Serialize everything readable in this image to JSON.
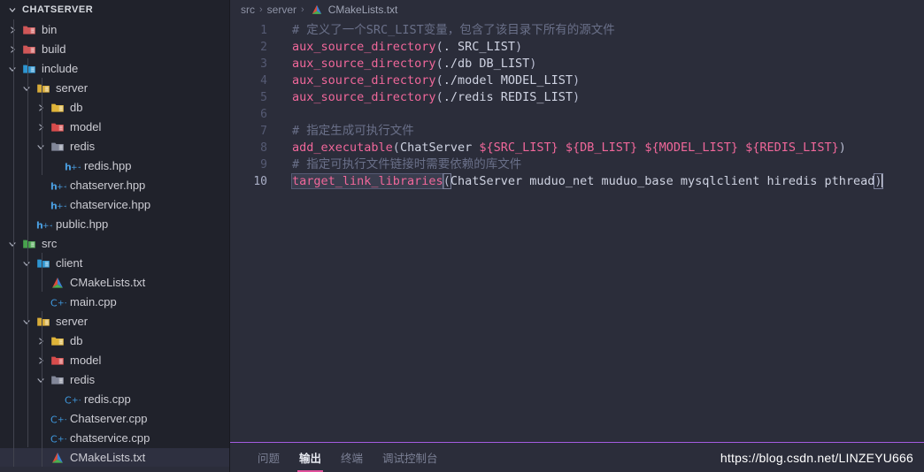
{
  "sidebar": {
    "header": {
      "title": "CHATSERVER",
      "twisty": "chevron-down-icon"
    },
    "items": [
      {
        "label": "bin",
        "depth": 1,
        "twisty": "chevron-right-icon",
        "icon": "folder-icon",
        "color": "#e05c5c",
        "type": "folder"
      },
      {
        "label": "build",
        "depth": 1,
        "twisty": "chevron-right-icon",
        "icon": "folder-icon",
        "color": "#e05c5c",
        "type": "folder"
      },
      {
        "label": "include",
        "depth": 1,
        "twisty": "chevron-down-icon",
        "icon": "folder-icon",
        "color": "#2f9fe0",
        "type": "folder"
      },
      {
        "label": "server",
        "depth": 2,
        "twisty": "chevron-down-icon",
        "icon": "folder-icon",
        "color": "#e8b93a",
        "type": "folder"
      },
      {
        "label": "db",
        "depth": 3,
        "twisty": "chevron-right-icon",
        "icon": "folder-icon",
        "color": "#f0c13b",
        "type": "folder"
      },
      {
        "label": "model",
        "depth": 3,
        "twisty": "chevron-right-icon",
        "icon": "folder-icon",
        "color": "#e8504f",
        "type": "folder"
      },
      {
        "label": "redis",
        "depth": 3,
        "twisty": "chevron-down-icon",
        "icon": "folder-icon",
        "color": "#8b90a3",
        "type": "folder"
      },
      {
        "label": "redis.hpp",
        "depth": 4,
        "twisty": "none",
        "icon": "hpp-file-icon",
        "color": "#4a9ee0",
        "type": "file"
      },
      {
        "label": "chatserver.hpp",
        "depth": 3,
        "twisty": "none",
        "icon": "hpp-file-icon",
        "color": "#4a9ee0",
        "type": "file"
      },
      {
        "label": "chatservice.hpp",
        "depth": 3,
        "twisty": "none",
        "icon": "hpp-file-icon",
        "color": "#4a9ee0",
        "type": "file"
      },
      {
        "label": "public.hpp",
        "depth": 2,
        "twisty": "none",
        "icon": "hpp-file-icon",
        "color": "#4a9ee0",
        "type": "file"
      },
      {
        "label": "src",
        "depth": 1,
        "twisty": "chevron-down-icon",
        "icon": "folder-icon",
        "color": "#4caf50",
        "type": "folder"
      },
      {
        "label": "client",
        "depth": 2,
        "twisty": "chevron-down-icon",
        "icon": "folder-icon",
        "color": "#2f9fe0",
        "type": "folder"
      },
      {
        "label": "CMakeLists.txt",
        "depth": 3,
        "twisty": "none",
        "icon": "cmake-file-icon",
        "color": "#d94f3d",
        "type": "file"
      },
      {
        "label": "main.cpp",
        "depth": 3,
        "twisty": "none",
        "icon": "cpp-file-icon",
        "color": "#4a9ee0",
        "type": "file"
      },
      {
        "label": "server",
        "depth": 2,
        "twisty": "chevron-down-icon",
        "icon": "folder-icon",
        "color": "#e8b93a",
        "type": "folder"
      },
      {
        "label": "db",
        "depth": 3,
        "twisty": "chevron-right-icon",
        "icon": "folder-icon",
        "color": "#f0c13b",
        "type": "folder"
      },
      {
        "label": "model",
        "depth": 3,
        "twisty": "chevron-right-icon",
        "icon": "folder-icon",
        "color": "#e8504f",
        "type": "folder"
      },
      {
        "label": "redis",
        "depth": 3,
        "twisty": "chevron-down-icon",
        "icon": "folder-icon",
        "color": "#8b90a3",
        "type": "folder"
      },
      {
        "label": "redis.cpp",
        "depth": 4,
        "twisty": "none",
        "icon": "cpp-file-icon",
        "color": "#4a9ee0",
        "type": "file"
      },
      {
        "label": "Chatserver.cpp",
        "depth": 3,
        "twisty": "none",
        "icon": "cpp-file-icon",
        "color": "#4a9ee0",
        "type": "file"
      },
      {
        "label": "chatservice.cpp",
        "depth": 3,
        "twisty": "none",
        "icon": "cpp-file-icon",
        "color": "#4a9ee0",
        "type": "file"
      },
      {
        "label": "CMakeLists.txt",
        "depth": 3,
        "twisty": "none",
        "icon": "cmake-file-icon",
        "color": "#d94f3d",
        "type": "file",
        "selected": true
      }
    ]
  },
  "breadcrumb": {
    "parts": [
      "src",
      "server"
    ],
    "separator": "›",
    "file": "CMakeLists.txt",
    "file_icon": "cmake-file-icon"
  },
  "editor": {
    "language": "cmake",
    "lines": [
      {
        "num": "1",
        "segments": [
          {
            "text": "# 定义了一个SRC_LIST变量，包含了该目录下所有的源文件",
            "cls": "tok-comment"
          }
        ]
      },
      {
        "num": "2",
        "segments": [
          {
            "text": "aux_source_directory",
            "cls": "tok-fn"
          },
          {
            "text": "(",
            "cls": "tok-paren"
          },
          {
            "text": ". SRC_LIST",
            "cls": "tok-plain"
          },
          {
            "text": ")",
            "cls": "tok-paren"
          }
        ]
      },
      {
        "num": "3",
        "segments": [
          {
            "text": "aux_source_directory",
            "cls": "tok-fn"
          },
          {
            "text": "(",
            "cls": "tok-paren"
          },
          {
            "text": "./db DB_LIST",
            "cls": "tok-plain"
          },
          {
            "text": ")",
            "cls": "tok-paren"
          }
        ]
      },
      {
        "num": "4",
        "segments": [
          {
            "text": "aux_source_directory",
            "cls": "tok-fn"
          },
          {
            "text": "(",
            "cls": "tok-paren"
          },
          {
            "text": "./model MODEL_LIST",
            "cls": "tok-plain"
          },
          {
            "text": ")",
            "cls": "tok-paren"
          }
        ]
      },
      {
        "num": "5",
        "segments": [
          {
            "text": "aux_source_directory",
            "cls": "tok-fn"
          },
          {
            "text": "(",
            "cls": "tok-paren"
          },
          {
            "text": "./redis REDIS_LIST",
            "cls": "tok-plain"
          },
          {
            "text": ")",
            "cls": "tok-paren"
          }
        ]
      },
      {
        "num": "6",
        "segments": []
      },
      {
        "num": "7",
        "segments": [
          {
            "text": "# 指定生成可执行文件",
            "cls": "tok-comment"
          }
        ]
      },
      {
        "num": "8",
        "segments": [
          {
            "text": "add_executable",
            "cls": "tok-fn"
          },
          {
            "text": "(",
            "cls": "tok-paren"
          },
          {
            "text": "ChatServer ",
            "cls": "tok-plain"
          },
          {
            "text": "${SRC_LIST}",
            "cls": "tok-var"
          },
          {
            "text": " ",
            "cls": "tok-plain"
          },
          {
            "text": "${DB_LIST}",
            "cls": "tok-var"
          },
          {
            "text": " ",
            "cls": "tok-plain"
          },
          {
            "text": "${MODEL_LIST}",
            "cls": "tok-var"
          },
          {
            "text": " ",
            "cls": "tok-plain"
          },
          {
            "text": "${REDIS_LIST}",
            "cls": "tok-var"
          },
          {
            "text": ")",
            "cls": "tok-paren"
          }
        ]
      },
      {
        "num": "9",
        "segments": [
          {
            "text": "# 指定可执行文件链接时需要依赖的库文件",
            "cls": "tok-comment"
          }
        ]
      },
      {
        "num": "10",
        "active": true,
        "segments": [
          {
            "text": "target_link_libraries",
            "cls": "tok-fn sel-box"
          },
          {
            "text": "(",
            "cls": "tok-paren bracket-box"
          },
          {
            "text": "ChatServer muduo_net muduo_base mysqlclient hiredis pthread",
            "cls": "tok-plain"
          },
          {
            "text": ")",
            "cls": "tok-paren bracket-box"
          }
        ],
        "caret": true
      }
    ]
  },
  "panel": {
    "tabs": [
      {
        "label": "问题",
        "active": false
      },
      {
        "label": "输出",
        "active": true
      },
      {
        "label": "终端",
        "active": false
      },
      {
        "label": "调试控制台",
        "active": false
      }
    ],
    "accent": "#e0519b",
    "border_top": "#a45be0"
  },
  "watermark": {
    "text": "https://blog.csdn.net/LINZEYU666"
  }
}
